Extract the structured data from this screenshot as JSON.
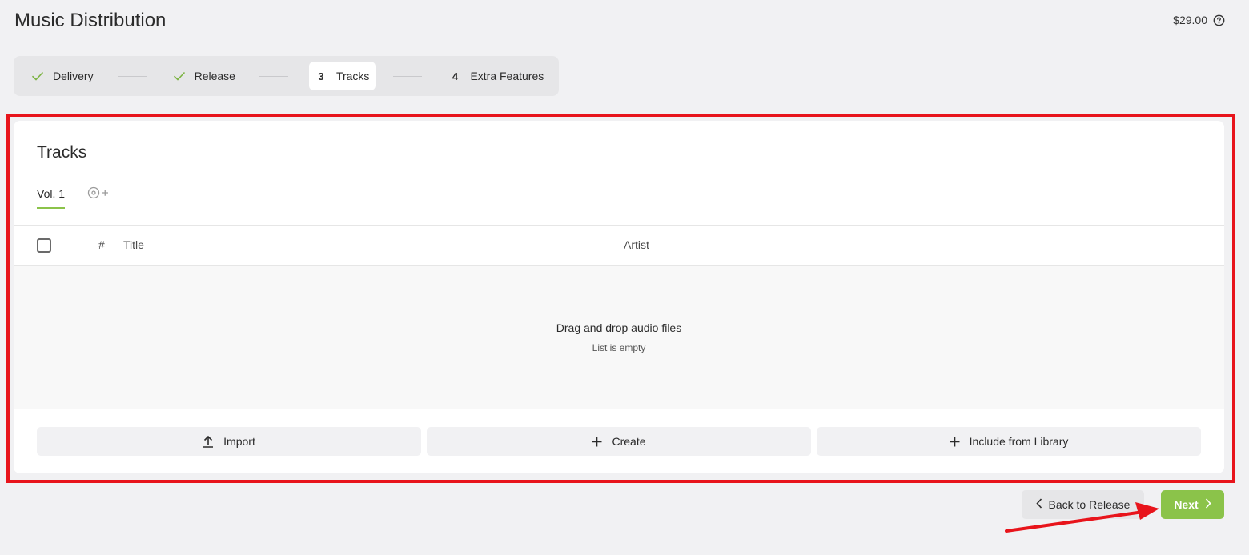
{
  "header": {
    "title": "Music Distribution",
    "price": "$29.00",
    "help_icon": "question-circle-icon"
  },
  "stepper": {
    "steps": [
      {
        "mark": "check",
        "label": "Delivery",
        "state": "done"
      },
      {
        "mark": "check",
        "label": "Release",
        "state": "done"
      },
      {
        "mark": "3",
        "label": "Tracks",
        "state": "active"
      },
      {
        "mark": "4",
        "label": "Extra Features",
        "state": "upcoming"
      }
    ]
  },
  "tracks": {
    "title": "Tracks",
    "volume_tab": "Vol. 1",
    "add_volume_icon": "add-disc-icon",
    "columns": {
      "num": "#",
      "title": "Title",
      "artist": "Artist"
    },
    "empty_main": "Drag and drop audio files",
    "empty_sub": "List is empty",
    "actions": {
      "import": "Import",
      "create": "Create",
      "library": "Include from Library"
    }
  },
  "footer": {
    "back": "Back to Release",
    "next": "Next"
  },
  "colors": {
    "accent": "#8bc34a",
    "annotation": "#e8141b",
    "background": "#f1f1f3"
  }
}
